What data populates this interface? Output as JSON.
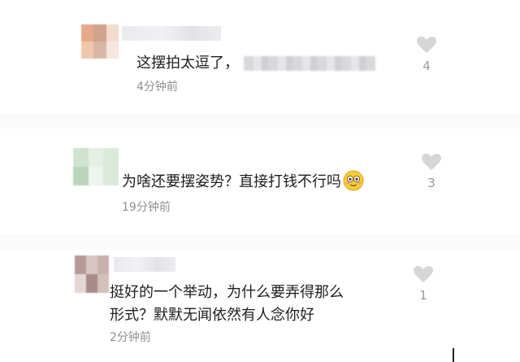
{
  "comments": [
    {
      "text": "这摆拍太逗了，",
      "time": "4分钟前",
      "likes": "4",
      "avatar_colors": [
        "#e6a98a",
        "#cfa38c",
        "#f3dccd",
        "#efc7ad",
        "#d9b7a6",
        "#f6e6de"
      ]
    },
    {
      "text": "为啥还要摆姿势？直接打钱不行吗",
      "time": "19分钟前",
      "likes": "3",
      "avatar_colors": [
        "#cfe3cf",
        "#e6efe6",
        "#d8ead8",
        "#b9d6ba",
        "#eef4ee",
        "#dbe9db"
      ]
    },
    {
      "text_line1": "挺好的一个举动，为什么要弄得那么",
      "text_line2": "形式？默默无闻依然有人念你好",
      "time": "2分钟前",
      "likes": "1",
      "avatar_colors": [
        "#b79a98",
        "#d8c6c4",
        "#c9b1ae",
        "#e4d7d5",
        "#a98c8a",
        "#d3bfbc"
      ]
    }
  ],
  "icons": {
    "like": "heart-icon",
    "emoji": "smiling-face-emoji"
  },
  "colors": {
    "heart": "#d6d6d6",
    "text": "#1e1e1e",
    "time": "#8f8f8f",
    "count": "#9a9a9a"
  }
}
